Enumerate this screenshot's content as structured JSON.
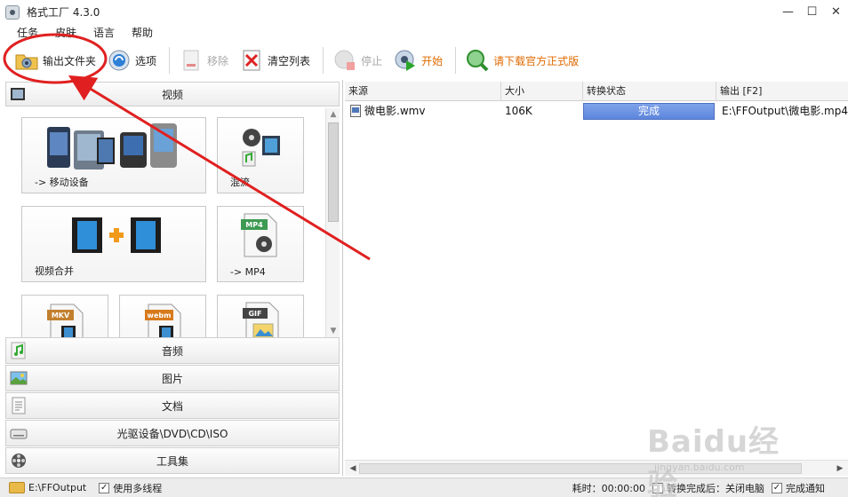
{
  "window": {
    "title": "格式工厂 4.3.0",
    "controls": [
      "—",
      "☐",
      "✕"
    ]
  },
  "menu": [
    "任务",
    "皮肤",
    "语言",
    "帮助"
  ],
  "toolbar": {
    "output_folder": "输出文件夹",
    "options": "选项",
    "remove": "移除",
    "clear_list": "清空列表",
    "stop": "停止",
    "start": "开始",
    "download": "请下载官方正式版"
  },
  "left": {
    "video_category": "视频",
    "tiles": [
      {
        "label": "-> 移动设备"
      },
      {
        "label": "混流"
      },
      {
        "label": "视频合并"
      },
      {
        "label": "-> MP4"
      },
      {
        "label": "MKV"
      },
      {
        "label": "webm"
      },
      {
        "label": "GIF"
      }
    ],
    "categories": [
      "音频",
      "图片",
      "文档",
      "光驱设备\\DVD\\CD\\ISO",
      "工具集"
    ]
  },
  "grid": {
    "headers": [
      "来源",
      "大小",
      "转换状态",
      "输出 [F2]"
    ],
    "rows": [
      {
        "source": "微电影.wmv",
        "size": "106K",
        "status": "完成",
        "output": "E:\\FFOutput\\微电影.mp4"
      }
    ]
  },
  "statusbar": {
    "folder": "E:\\FFOutput",
    "multithread_label": "使用多线程",
    "elapsed": "耗时：00:00:00",
    "after_convert": "转换完成后：关闭电脑",
    "notify": "完成通知"
  },
  "watermark": {
    "brand": "Baidu经验",
    "url": "jingyan.baidu.com"
  },
  "colors": {
    "status_done": "#5d86dc",
    "annotation_red": "#e02020",
    "download_orange": "#e06a00"
  }
}
